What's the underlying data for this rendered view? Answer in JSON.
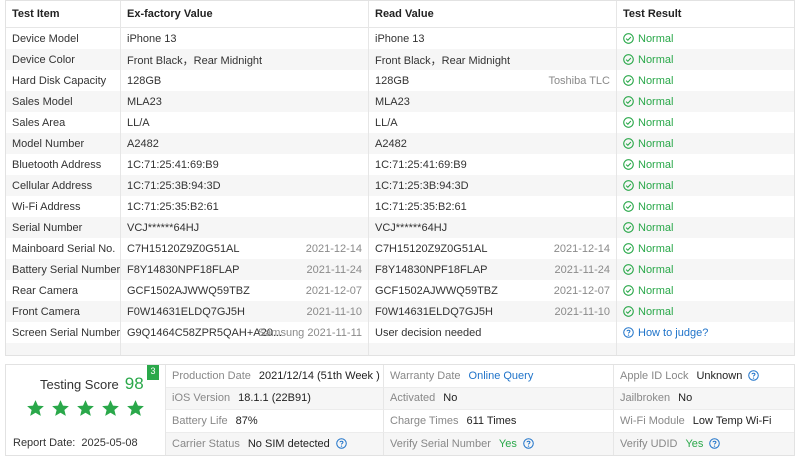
{
  "table": {
    "headers": [
      "Test Item",
      "Ex-factory Value",
      "Read Value",
      "Test Result"
    ],
    "rows": [
      {
        "item": "Device Model",
        "ex": "iPhone 13",
        "ex_side": "",
        "read": "iPhone 13",
        "read_side": "",
        "result": "Normal"
      },
      {
        "item": "Device Color",
        "ex": "Front Black，Rear Midnight",
        "ex_side": "",
        "read": "Front Black，Rear Midnight",
        "read_side": "",
        "result": "Normal"
      },
      {
        "item": "Hard Disk Capacity",
        "ex": "128GB",
        "ex_side": "",
        "read": "128GB",
        "read_side": "Toshiba TLC",
        "result": "Normal"
      },
      {
        "item": "Sales Model",
        "ex": "MLA23",
        "ex_side": "",
        "read": "MLA23",
        "read_side": "",
        "result": "Normal"
      },
      {
        "item": "Sales Area",
        "ex": "LL/A",
        "ex_side": "",
        "read": "LL/A",
        "read_side": "",
        "result": "Normal"
      },
      {
        "item": "Model Number",
        "ex": "A2482",
        "ex_side": "",
        "read": "A2482",
        "read_side": "",
        "result": "Normal"
      },
      {
        "item": "Bluetooth Address",
        "ex": "1C:71:25:41:69:B9",
        "ex_side": "",
        "read": "1C:71:25:41:69:B9",
        "read_side": "",
        "result": "Normal"
      },
      {
        "item": "Cellular Address",
        "ex": "1C:71:25:3B:94:3D",
        "ex_side": "",
        "read": "1C:71:25:3B:94:3D",
        "read_side": "",
        "result": "Normal"
      },
      {
        "item": "Wi-Fi Address",
        "ex": "1C:71:25:35:B2:61",
        "ex_side": "",
        "read": "1C:71:25:35:B2:61",
        "read_side": "",
        "result": "Normal"
      },
      {
        "item": "Serial Number",
        "ex": "VCJ******64HJ",
        "ex_side": "",
        "read": "VCJ******64HJ",
        "read_side": "",
        "result": "Normal"
      },
      {
        "item": "Mainboard Serial No.",
        "ex": "C7H15120Z9Z0G51AL",
        "ex_side": "2021-12-14",
        "read": "C7H15120Z9Z0G51AL",
        "read_side": "2021-12-14",
        "result": "Normal"
      },
      {
        "item": "Battery Serial Number",
        "ex": "F8Y14830NPF18FLAP",
        "ex_side": "2021-11-24",
        "read": "F8Y14830NPF18FLAP",
        "read_side": "2021-11-24",
        "result": "Normal"
      },
      {
        "item": "Rear Camera",
        "ex": "GCF1502AJWWQ59TBZ",
        "ex_side": "2021-12-07",
        "read": "GCF1502AJWWQ59TBZ",
        "read_side": "2021-12-07",
        "result": "Normal"
      },
      {
        "item": "Front Camera",
        "ex": "F0W14631ELDQ7GJ5H",
        "ex_side": "2021-11-10",
        "read": "F0W14631ELDQ7GJ5H",
        "read_side": "2021-11-10",
        "result": "Normal"
      },
      {
        "item": "Screen Serial Number",
        "ex": "G9Q1464C58ZPR5QAH+A20...",
        "ex_side": "Samsung 2021-11-11",
        "read": "User decision needed",
        "read_side": "",
        "result": "How to judge?",
        "result_link": true
      }
    ]
  },
  "score": {
    "title": "Testing Score",
    "value": "98",
    "badge": "3",
    "stars": 5,
    "report_label": "Report Date:",
    "report_date": "2025-05-08"
  },
  "info": [
    {
      "label": "Production Date",
      "value": "2021/12/14 (51th Week )"
    },
    {
      "label": "Warranty Date",
      "value": "Online Query",
      "style": "link"
    },
    {
      "label": "Apple ID Lock",
      "value": "Unknown",
      "help": true
    },
    {
      "label": "iOS Version",
      "value": "18.1.1 (22B91)"
    },
    {
      "label": "Activated",
      "value": "No"
    },
    {
      "label": "Jailbroken",
      "value": "No"
    },
    {
      "label": "Battery Life",
      "value": "87%"
    },
    {
      "label": "Charge Times",
      "value": "611 Times"
    },
    {
      "label": "Wi-Fi Module",
      "value": "Low Temp Wi-Fi"
    },
    {
      "label": "Carrier Status",
      "value": "No SIM detected",
      "help": true
    },
    {
      "label": "Verify Serial Number",
      "value": "Yes",
      "style": "green",
      "help": true
    },
    {
      "label": "Verify UDID",
      "value": "Yes",
      "style": "green",
      "help": true
    }
  ],
  "colors": {
    "accent": "#2aa84a",
    "link": "#1f73c9"
  }
}
